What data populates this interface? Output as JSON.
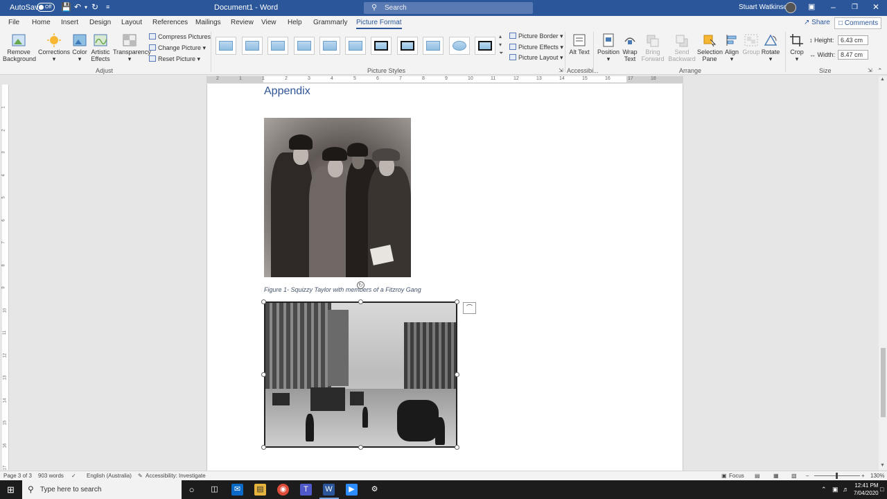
{
  "titlebar": {
    "autosave_label": "AutoSave",
    "autosave_state": "Off",
    "doc_title": "Document1  -  Word",
    "search_placeholder": "Search",
    "user_name": "Stuart Watkinson"
  },
  "tabs": [
    "File",
    "Home",
    "Insert",
    "Design",
    "Layout",
    "References",
    "Mailings",
    "Review",
    "View",
    "Help",
    "Grammarly",
    "Picture Format"
  ],
  "active_tab": "Picture Format",
  "share_label": "Share",
  "comments_label": "Comments",
  "ribbon": {
    "adjust": {
      "remove_background": "Remove Background",
      "corrections": "Corrections",
      "color": "Color",
      "artistic_effects": "Artistic Effects",
      "transparency": "Transparency",
      "compress_pictures": "Compress Pictures",
      "change_picture": "Change Picture",
      "reset_picture": "Reset Picture",
      "group_label": "Adjust"
    },
    "picture_styles": {
      "picture_border": "Picture Border",
      "picture_effects": "Picture Effects",
      "picture_layout": "Picture Layout",
      "group_label": "Picture Styles"
    },
    "accessibility": {
      "alt_text": "Alt Text",
      "group_label": "Accessibi..."
    },
    "arrange": {
      "position": "Position",
      "wrap_text": "Wrap Text",
      "bring_forward": "Bring Forward",
      "send_backward": "Send Backward",
      "selection_pane": "Selection Pane",
      "align": "Align",
      "group": "Group",
      "rotate": "Rotate",
      "group_label": "Arrange"
    },
    "size": {
      "crop": "Crop",
      "height_label": "Height:",
      "height_value": "6.43 cm",
      "width_label": "Width:",
      "width_value": "8.47 cm",
      "group_label": "Size"
    }
  },
  "document": {
    "heading": "Appendix",
    "figure_caption": "Figure 1- Squizzy Taylor with members of a Fitzroy Gang"
  },
  "ruler_numbers": [
    "2",
    "1",
    "1",
    "2",
    "3",
    "4",
    "5",
    "6",
    "7",
    "8",
    "9",
    "10",
    "11",
    "12",
    "13",
    "14",
    "15",
    "16",
    "17",
    "18"
  ],
  "vruler_numbers": [
    "1",
    "2",
    "3",
    "4",
    "5",
    "6",
    "7",
    "8",
    "9",
    "10",
    "11",
    "12",
    "13",
    "14",
    "15",
    "16",
    "17"
  ],
  "statusbar": {
    "page": "Page 3 of 3",
    "words": "903 words",
    "language": "English (Australia)",
    "accessibility": "Accessibility: Investigate",
    "focus": "Focus",
    "zoom": "130%"
  },
  "taskbar": {
    "search_placeholder": "Type here to search",
    "time": "12:41 PM",
    "date": "7/04/2020"
  },
  "colors": {
    "word_blue": "#2b579a",
    "heading_blue": "#2f5496"
  }
}
